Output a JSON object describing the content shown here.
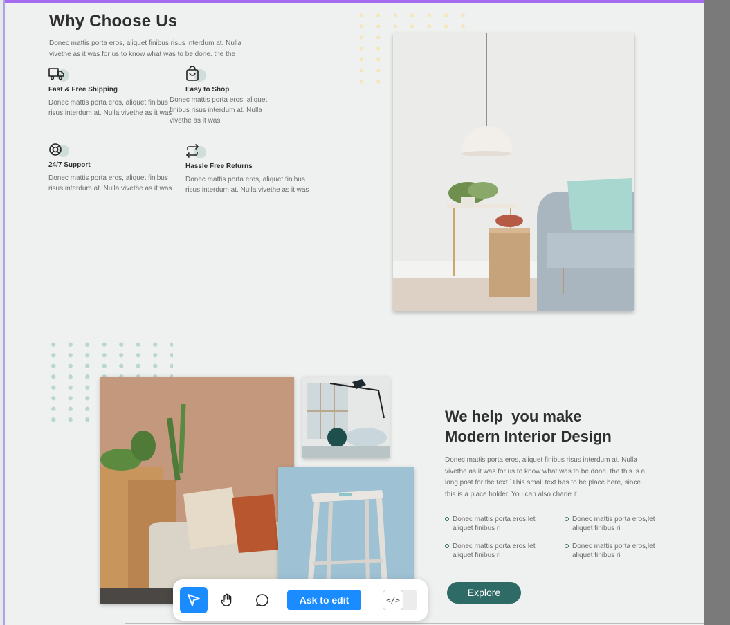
{
  "why": {
    "title": "Why Choose Us",
    "intro": "Donec mattis porta eros, aliquet finibus risus interdum at. Nulla vivethe as it was for us to know what was to be done. the the",
    "features": [
      {
        "icon": "truck-icon",
        "title": "Fast  & Free Shipping",
        "desc": "Donec mattis porta eros, aliquet finibus risus interdum at. Nulla vivethe as it was"
      },
      {
        "icon": "shopping-bag-icon",
        "title": "Easy to Shop",
        "desc": "Donec mattis porta eros, aliquet finibus risus interdum at. Nulla vivethe as it was"
      },
      {
        "icon": "lifebuoy-icon",
        "title": "24/7 Support",
        "desc": "Donec mattis porta eros, aliquet finibus risus interdum at. Nulla vivethe as it was"
      },
      {
        "icon": "repeat-icon",
        "title": "Hassle Free Returns",
        "desc": "Donec mattis porta eros, aliquet finibus risus interdum at. Nulla vivethe as it was"
      }
    ]
  },
  "help": {
    "title": "We help  you make\nModern Interior Design",
    "desc": "Donec mattis porta eros, aliquet finibus risus interdum at. Nulla vivethe as it was for us to know what was to be done. the this is a long  post for the text.`This small text has to be place here, since this is a place holder. You can also chane it.",
    "bullets": [
      "Donec mattis porta eros,let aliquet finibus ri",
      "Donec mattis porta eros,let aliquet finibus ri",
      "Donec mattis porta eros,let aliquet finibus ri",
      "Donec mattis porta eros,let aliquet finibus ri"
    ],
    "explore_label": "Explore"
  },
  "toolbar": {
    "ask_label": "Ask to edit",
    "code_label": "</>",
    "accent": "#1a8cff"
  },
  "colors": {
    "brand": "#2f6b66",
    "background": "#eff1f0",
    "dots_yellow": "#f4e6b8",
    "dots_teal": "#b9d7d2"
  }
}
